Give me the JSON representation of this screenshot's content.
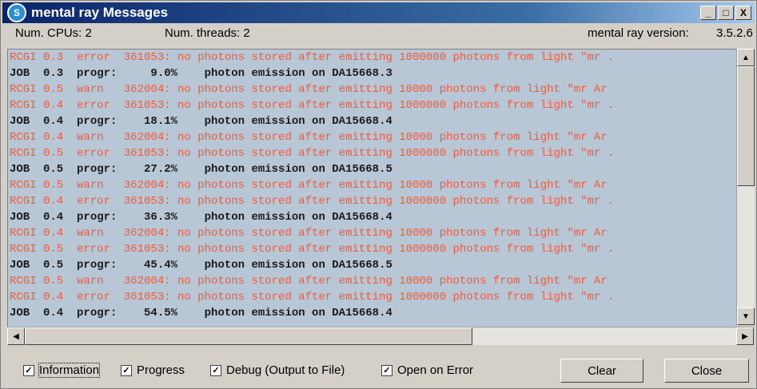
{
  "window": {
    "title": "mental ray Messages",
    "min_glyph": "_",
    "max_glyph": "□",
    "close_glyph": "X"
  },
  "info": {
    "cpus": "Num. CPUs: 2",
    "threads": "Num. threads: 2",
    "version_label": "mental ray version:",
    "version_value": "3.5.2.6"
  },
  "log": [
    {
      "text": "RCGI 0.3  error  361053: no photons stored after emitting 1000000 photons from light \"mr .",
      "kind": "red"
    },
    {
      "text": "JOB  0.3  progr:     9.0%    photon emission on DA15668.3",
      "kind": "black"
    },
    {
      "text": "RCGI 0.5  warn   362004: no photons stored after emitting 10000 photons from light \"mr Ar",
      "kind": "red"
    },
    {
      "text": "RCGI 0.4  error  361053: no photons stored after emitting 1000000 photons from light \"mr .",
      "kind": "red"
    },
    {
      "text": "JOB  0.4  progr:    18.1%    photon emission on DA15668.4",
      "kind": "black"
    },
    {
      "text": "RCGI 0.4  warn   362004: no photons stored after emitting 10000 photons from light \"mr Ar",
      "kind": "red"
    },
    {
      "text": "RCGI 0.5  error  361053: no photons stored after emitting 1000000 photons from light \"mr .",
      "kind": "red"
    },
    {
      "text": "JOB  0.5  progr:    27.2%    photon emission on DA15668.5",
      "kind": "black"
    },
    {
      "text": "RCGI 0.5  warn   362004: no photons stored after emitting 10000 photons from light \"mr Ar",
      "kind": "red"
    },
    {
      "text": "RCGI 0.4  error  361053: no photons stored after emitting 1000000 photons from light \"mr .",
      "kind": "red"
    },
    {
      "text": "JOB  0.4  progr:    36.3%    photon emission on DA15668.4",
      "kind": "black"
    },
    {
      "text": "RCGI 0.4  warn   362004: no photons stored after emitting 10000 photons from light \"mr Ar",
      "kind": "red"
    },
    {
      "text": "RCGI 0.5  error  361053: no photons stored after emitting 1000000 photons from light \"mr .",
      "kind": "red"
    },
    {
      "text": "JOB  0.5  progr:    45.4%    photon emission on DA15668.5",
      "kind": "black"
    },
    {
      "text": "RCGI 0.5  warn   362004: no photons stored after emitting 10000 photons from light \"mr Ar",
      "kind": "red"
    },
    {
      "text": "RCGI 0.4  error  361053: no photons stored after emitting 1000000 photons from light \"mr .",
      "kind": "red"
    },
    {
      "text": "JOB  0.4  progr:    54.5%    photon emission on DA15668.4",
      "kind": "black"
    }
  ],
  "checkboxes": {
    "information": {
      "label": "Information",
      "checked": "✓"
    },
    "progress": {
      "label": "Progress",
      "checked": "✓"
    },
    "debug": {
      "label": "Debug (Output to File)",
      "checked": "✓"
    },
    "open_on_error": {
      "label": "Open on Error",
      "checked": "✓"
    }
  },
  "buttons": {
    "clear": "Clear",
    "close": "Close"
  },
  "colors": {
    "log_bg": "#b8c7d6",
    "error_text": "#f05a3a",
    "job_text": "#1a1a1a"
  }
}
